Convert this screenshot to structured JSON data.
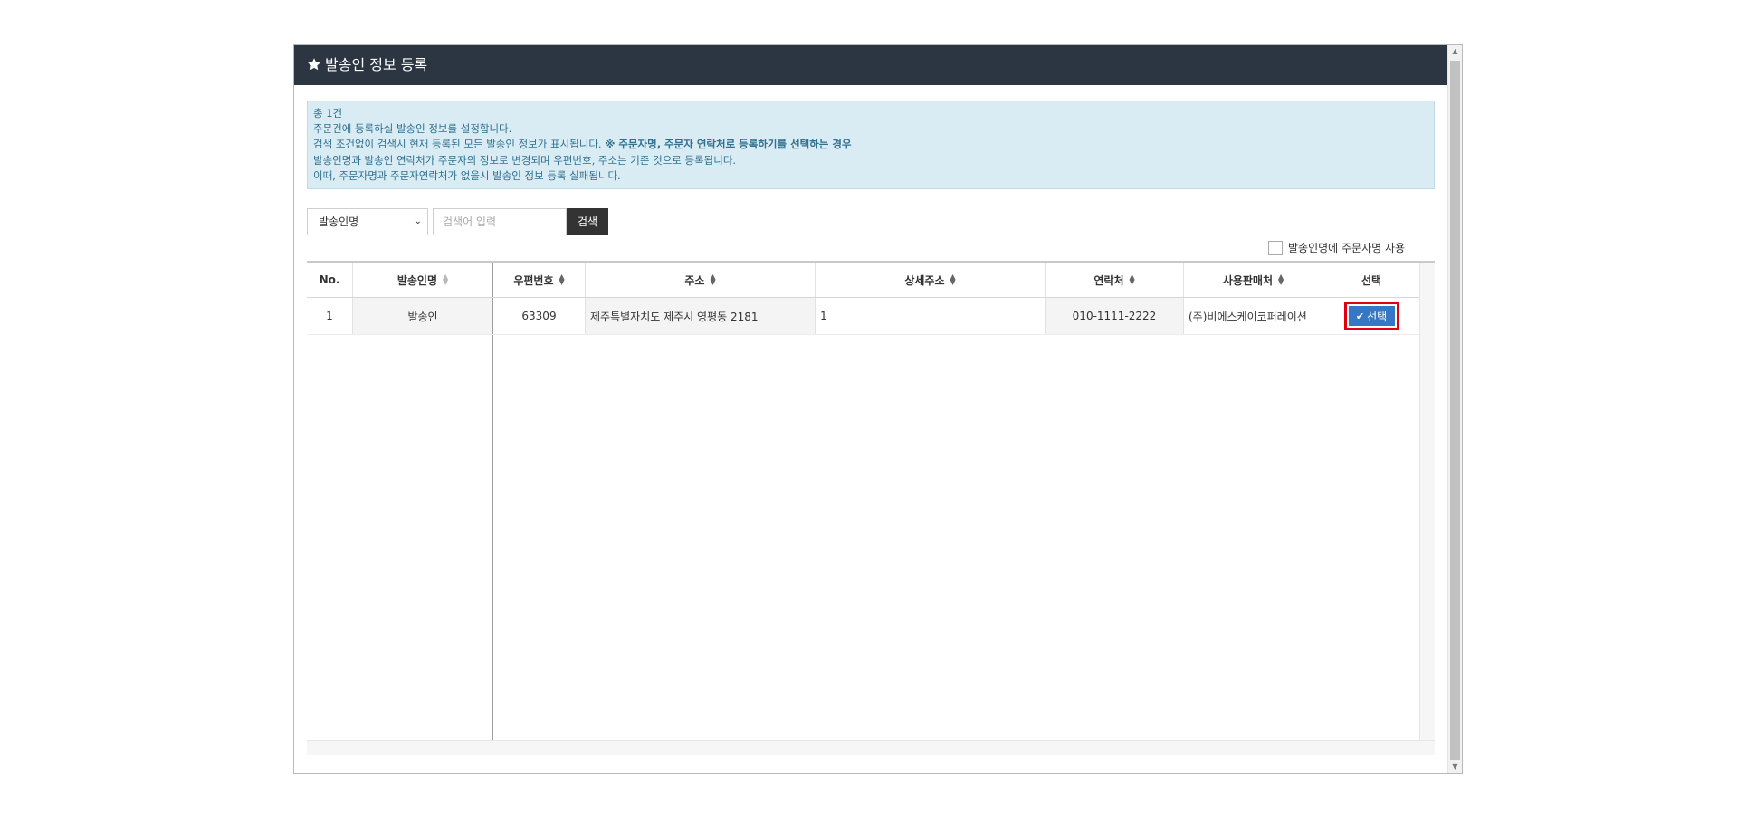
{
  "window": {
    "title": "발송인 정보 등록",
    "title_icon": "star-icon"
  },
  "notice": {
    "count": "총 1건",
    "line1": "주문건에 등록하실 발송인 정보를 설정합니다.",
    "line2_prefix": "검색 조건없이 검색시 현재 등록된 모든 발송인 정보가 표시됩니다. ",
    "line2_bold": "※ 주문자명, 주문자 연락처로 등록하기를 선택하는 경우",
    "line3": "발송인명과 발송인 연락처가 주문자의 정보로 변경되며 우편번호, 주소는 기존 것으로 등록됩니다.",
    "line4": "이때, 주문자명과 주문자연락처가 없을시 발송인 정보 등록 실패됩니다."
  },
  "search": {
    "field_selected": "발송인명",
    "placeholder": "검색어 입력",
    "button_label": "검색"
  },
  "options": {
    "use_orderer_name_label": "발송인명에 주문자명 사용",
    "use_orderer_name_checked": false
  },
  "grid": {
    "columns": {
      "no": "No.",
      "sender_name": "발송인명",
      "zip": "우편번호",
      "address": "주소",
      "address_detail": "상세주소",
      "phone": "연락처",
      "seller": "사용판매처",
      "select": "선택"
    },
    "rows": [
      {
        "no": "1",
        "sender_name": "발송인",
        "zip": "63309",
        "address": "제주특별자치도 제주시 영평동 2181",
        "address_detail": "1",
        "phone": "010-1111-2222",
        "seller": "(주)비에스케이코퍼레이션",
        "select_label": "선택"
      }
    ]
  },
  "colors": {
    "title_bar": "#2b3642",
    "notice_bg": "#d9ecf4",
    "notice_text": "#31708f",
    "select_button": "#3478c5",
    "highlight": "#e0000f"
  }
}
